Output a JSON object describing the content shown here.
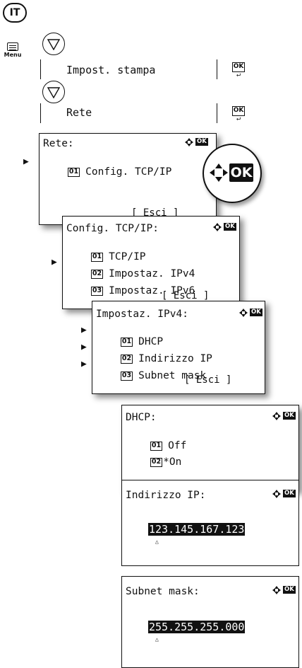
{
  "lang_badge": "IT",
  "menu_key_label": "Menu",
  "steps": [
    {
      "label": "Impost. stampa",
      "key": "OK"
    },
    {
      "label": "Rete",
      "key": "OK"
    }
  ],
  "ok_zoom_label": "OK",
  "ok_badge": "OK",
  "screens": {
    "rete": {
      "title": "Rete:",
      "items": [
        {
          "num": "01",
          "label": "Config. TCP/IP"
        }
      ],
      "esc": "[ Esci ]"
    },
    "tcpip": {
      "title": "Config. TCP/IP:",
      "items": [
        {
          "num": "01",
          "label": "TCP/IP"
        },
        {
          "num": "02",
          "label": "Impostaz. IPv4"
        },
        {
          "num": "03",
          "label": "Impostaz. IPv6"
        }
      ],
      "esc": "[ Esci ]"
    },
    "ipv4": {
      "title": "Impostaz. IPv4:",
      "items": [
        {
          "num": "01",
          "label": "DHCP"
        },
        {
          "num": "02",
          "label": "Indirizzo IP"
        },
        {
          "num": "03",
          "label": "Subnet mask"
        }
      ],
      "esc": "[ Esci ]"
    },
    "dhcp": {
      "title": "DHCP:",
      "items": [
        {
          "num": "01",
          "label": "Off"
        },
        {
          "num": "02",
          "label": "*On"
        }
      ]
    },
    "ipaddr": {
      "title": "Indirizzo IP:",
      "value": "123.145.167.123",
      "caret": "△"
    },
    "subnet": {
      "title": "Subnet mask:",
      "value": "255.255.255.000",
      "caret": "△"
    }
  },
  "pointer": "▶"
}
